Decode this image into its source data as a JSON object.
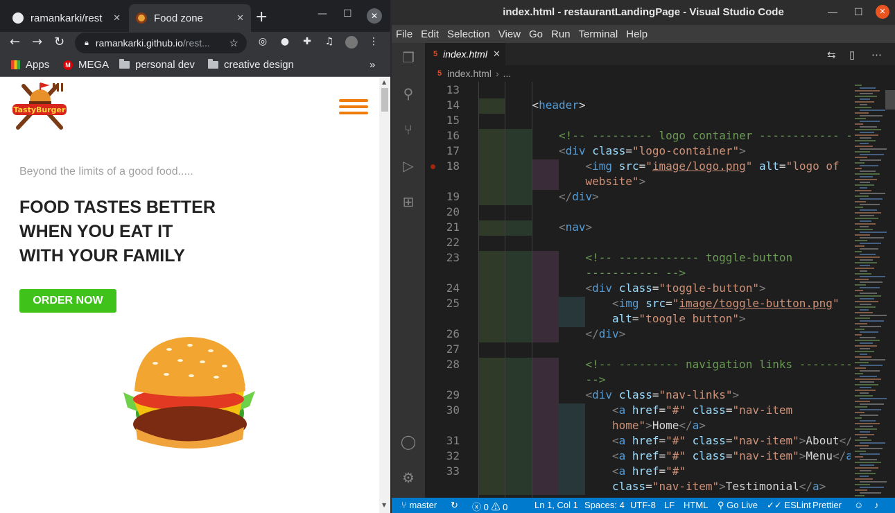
{
  "browser": {
    "tabs": [
      {
        "title": "ramankarki/rest",
        "favicon": "github-icon"
      },
      {
        "title": "Food zone",
        "favicon": "burger-icon"
      }
    ],
    "url_host": "ramankarki.github.io",
    "url_path": "/rest...",
    "bookmarks": [
      {
        "label": "Apps",
        "icon": "apps-grid-icon"
      },
      {
        "label": "MEGA",
        "icon": "mega-icon"
      },
      {
        "label": "personal dev",
        "icon": "folder-icon"
      },
      {
        "label": "creative design",
        "icon": "folder-icon"
      }
    ],
    "more_bookmarks": "»"
  },
  "site": {
    "logo_text": "TastyBurger",
    "tagline": "Beyond the limits of a good food.....",
    "headline": [
      "FOOD TASTES BETTER",
      "WHEN YOU EAT IT",
      "WITH YOUR FAMILY"
    ],
    "cta": "ORDER NOW",
    "accent_color": "#f07d0b",
    "cta_color": "#3fc31b"
  },
  "vscode": {
    "title": "index.html - restaurantLandingPage - Visual Studio Code",
    "menu": [
      "File",
      "Edit",
      "Selection",
      "View",
      "Go",
      "Run",
      "Terminal",
      "Help"
    ],
    "tab": "index.html",
    "breadcrumb": "index.html",
    "breadcrumb_more": "...",
    "lines": [
      {
        "n": "13",
        "parts": []
      },
      {
        "n": "14",
        "parts": [
          [
            "tx",
            "<"
          ],
          [
            "tg",
            "header"
          ],
          [
            "tx",
            ">"
          ]
        ]
      },
      {
        "n": "15",
        "parts": []
      },
      {
        "n": "16",
        "parts": [
          [
            "g",
            "<!-- --------- logo container ------------ -->"
          ]
        ]
      },
      {
        "n": "17",
        "parts": [
          [
            "pn",
            "<"
          ],
          [
            "tg",
            "div"
          ],
          [
            "tx",
            " "
          ],
          [
            "at",
            "class"
          ],
          [
            "tx",
            "="
          ],
          [
            "st",
            "\"logo-container\""
          ],
          [
            "pn",
            ">"
          ]
        ]
      },
      {
        "n": "18",
        "parts": [
          [
            "pn",
            "<"
          ],
          [
            "tg",
            "img"
          ],
          [
            "tx",
            " "
          ],
          [
            "at",
            "src"
          ],
          [
            "tx",
            "="
          ],
          [
            "st",
            "\""
          ],
          [
            "su",
            "image/logo.png"
          ],
          [
            "st",
            "\""
          ],
          [
            "tx",
            " "
          ],
          [
            "at",
            "alt"
          ],
          [
            "tx",
            "="
          ],
          [
            "st",
            "\"logo of"
          ]
        ]
      },
      {
        "n": "",
        "parts": [
          [
            "st",
            "website\""
          ],
          [
            "pn",
            ">"
          ]
        ]
      },
      {
        "n": "19",
        "parts": [
          [
            "pn",
            "</"
          ],
          [
            "tg",
            "div"
          ],
          [
            "pn",
            ">"
          ]
        ]
      },
      {
        "n": "20",
        "parts": []
      },
      {
        "n": "21",
        "parts": [
          [
            "pn",
            "<"
          ],
          [
            "tg",
            "nav"
          ],
          [
            "pn",
            ">"
          ]
        ]
      },
      {
        "n": "22",
        "parts": []
      },
      {
        "n": "23",
        "parts": [
          [
            "g",
            "<!-- ------------ toggle-button"
          ]
        ]
      },
      {
        "n": "",
        "parts": [
          [
            "g",
            "----------- -->"
          ]
        ]
      },
      {
        "n": "24",
        "parts": [
          [
            "pn",
            "<"
          ],
          [
            "tg",
            "div"
          ],
          [
            "tx",
            " "
          ],
          [
            "at",
            "class"
          ],
          [
            "tx",
            "="
          ],
          [
            "st",
            "\"toggle-button\""
          ],
          [
            "pn",
            ">"
          ]
        ]
      },
      {
        "n": "25",
        "parts": [
          [
            "pn",
            "<"
          ],
          [
            "tg",
            "img"
          ],
          [
            "tx",
            " "
          ],
          [
            "at",
            "src"
          ],
          [
            "tx",
            "="
          ],
          [
            "st",
            "\""
          ],
          [
            "su",
            "image/toggle-button.png"
          ],
          [
            "st",
            "\""
          ]
        ]
      },
      {
        "n": "",
        "parts": [
          [
            "at",
            "alt"
          ],
          [
            "tx",
            "="
          ],
          [
            "st",
            "\"toogle button\""
          ],
          [
            "pn",
            ">"
          ]
        ]
      },
      {
        "n": "26",
        "parts": [
          [
            "pn",
            "</"
          ],
          [
            "tg",
            "div"
          ],
          [
            "pn",
            ">"
          ]
        ]
      },
      {
        "n": "27",
        "parts": []
      },
      {
        "n": "28",
        "parts": [
          [
            "g",
            "<!-- --------- navigation links ---------"
          ]
        ]
      },
      {
        "n": "",
        "parts": [
          [
            "g",
            "-->"
          ]
        ]
      },
      {
        "n": "29",
        "parts": [
          [
            "pn",
            "<"
          ],
          [
            "tg",
            "div"
          ],
          [
            "tx",
            " "
          ],
          [
            "at",
            "class"
          ],
          [
            "tx",
            "="
          ],
          [
            "st",
            "\"nav-links\""
          ],
          [
            "pn",
            ">"
          ]
        ]
      },
      {
        "n": "30",
        "parts": [
          [
            "pn",
            "<"
          ],
          [
            "tg",
            "a"
          ],
          [
            "tx",
            " "
          ],
          [
            "at",
            "href"
          ],
          [
            "tx",
            "="
          ],
          [
            "st",
            "\"#\""
          ],
          [
            "tx",
            " "
          ],
          [
            "at",
            "class"
          ],
          [
            "tx",
            "="
          ],
          [
            "st",
            "\"nav-item"
          ]
        ]
      },
      {
        "n": "",
        "parts": [
          [
            "st",
            "home\""
          ],
          [
            "pn",
            ">"
          ],
          [
            "tx",
            "Home"
          ],
          [
            "pn",
            "</"
          ],
          [
            "tg",
            "a"
          ],
          [
            "pn",
            ">"
          ]
        ]
      },
      {
        "n": "31",
        "parts": [
          [
            "pn",
            "<"
          ],
          [
            "tg",
            "a"
          ],
          [
            "tx",
            " "
          ],
          [
            "at",
            "href"
          ],
          [
            "tx",
            "="
          ],
          [
            "st",
            "\"#\""
          ],
          [
            "tx",
            " "
          ],
          [
            "at",
            "class"
          ],
          [
            "tx",
            "="
          ],
          [
            "st",
            "\"nav-item\""
          ],
          [
            "pn",
            ">"
          ],
          [
            "tx",
            "About"
          ],
          [
            "pn",
            "</"
          ],
          [
            "tg",
            "a"
          ],
          [
            "pn",
            ">"
          ]
        ]
      },
      {
        "n": "32",
        "parts": [
          [
            "pn",
            "<"
          ],
          [
            "tg",
            "a"
          ],
          [
            "tx",
            " "
          ],
          [
            "at",
            "href"
          ],
          [
            "tx",
            "="
          ],
          [
            "st",
            "\"#\""
          ],
          [
            "tx",
            " "
          ],
          [
            "at",
            "class"
          ],
          [
            "tx",
            "="
          ],
          [
            "st",
            "\"nav-item\""
          ],
          [
            "pn",
            ">"
          ],
          [
            "tx",
            "Menu"
          ],
          [
            "pn",
            "</"
          ],
          [
            "tg",
            "a"
          ],
          [
            "pn",
            ">"
          ]
        ]
      },
      {
        "n": "33",
        "parts": [
          [
            "pn",
            "<"
          ],
          [
            "tg",
            "a"
          ],
          [
            "tx",
            " "
          ],
          [
            "at",
            "href"
          ],
          [
            "tx",
            "="
          ],
          [
            "st",
            "\"#\""
          ]
        ]
      },
      {
        "n": "",
        "parts": [
          [
            "at",
            "class"
          ],
          [
            "tx",
            "="
          ],
          [
            "st",
            "\"nav-item\""
          ],
          [
            "pn",
            ">"
          ],
          [
            "tx",
            "Testimonial"
          ],
          [
            "pn",
            "</"
          ],
          [
            "tg",
            "a"
          ],
          [
            "pn",
            ">"
          ]
        ]
      }
    ],
    "status": {
      "branch": "master",
      "errors": "0",
      "warnings": "0",
      "position": "Ln 1, Col 1",
      "spaces": "Spaces: 4",
      "encoding": "UTF-8",
      "eol": "LF",
      "language": "HTML",
      "golive": "Go Live",
      "eslint": "ESLint",
      "prettier": "Prettier"
    }
  }
}
